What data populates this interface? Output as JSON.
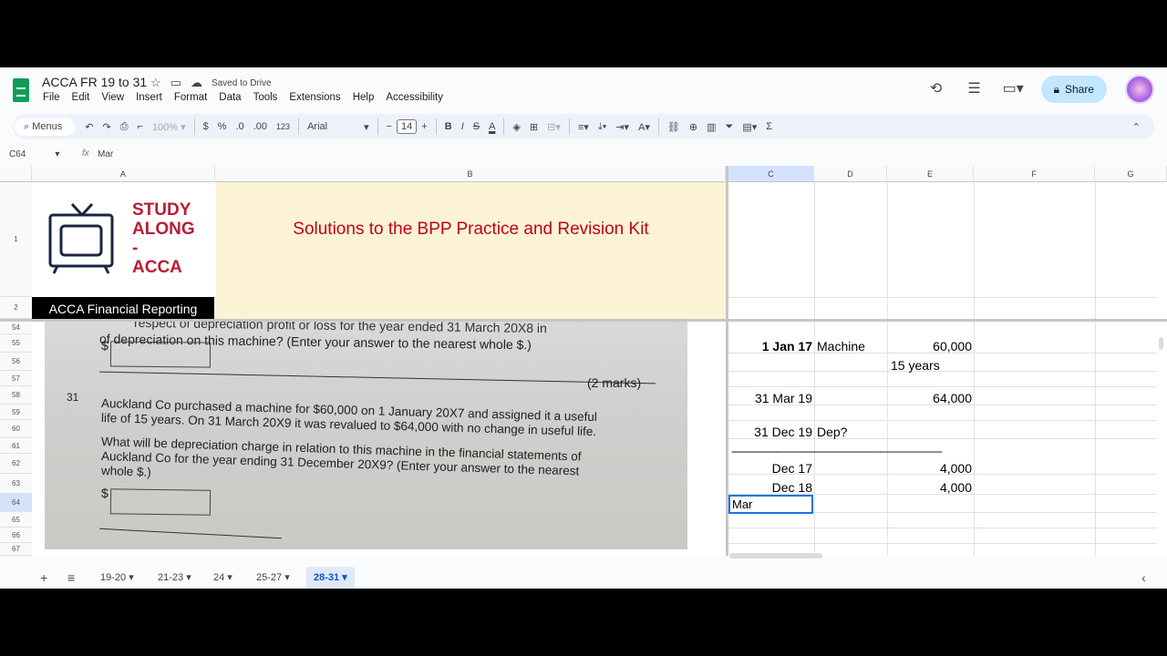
{
  "doc": {
    "title": "ACCA FR 19 to 31",
    "saved": "Saved to Drive"
  },
  "menu": [
    "File",
    "Edit",
    "View",
    "Insert",
    "Format",
    "Data",
    "Tools",
    "Extensions",
    "Help",
    "Accessibility"
  ],
  "toolbar": {
    "menus": "Menus",
    "zoom": "100%",
    "currency": "$",
    "percent": "%",
    "dec_dec": ".0",
    "dec_inc": ".00",
    "numfmt": "123",
    "font": "Arial",
    "size": "14",
    "bold": "B",
    "italic": "I",
    "strike": "S",
    "textcolor": "A",
    "sum": "Σ"
  },
  "share": "Share",
  "formula": {
    "cell": "C64",
    "fx": "fx",
    "value": "Mar"
  },
  "columns": [
    "A",
    "B",
    "C",
    "D",
    "E",
    "F",
    "G"
  ],
  "rows_top": [
    "1",
    "2"
  ],
  "rows_bottom": [
    "54",
    "55",
    "56",
    "57",
    "58",
    "59",
    "60",
    "61",
    "62",
    "63",
    "64",
    "65",
    "66",
    "67"
  ],
  "banner": {
    "study": "STUDY",
    "along": "ALONG",
    "dash": "-",
    "acca": "ACCA",
    "title": "Solutions to the BPP Practice and Revision Kit",
    "label": "ACCA Financial Reporting"
  },
  "photo": {
    "l1": "of depreciation on this machine? (Enter your answer to the nearest whole $.)",
    "l0": "respect of depreciation           profit or loss for the year ended 31 March 20X8 in",
    "dollar1": "$",
    "marks": "(2 marks)",
    "qnum": "31",
    "q1": "Auckland Co purchased a machine for $60,000 on 1 January 20X7 and assigned it a useful",
    "q2": "life of 15 years. On 31 March 20X9 it was revalued to $64,000 with no change in useful life.",
    "q3": "What will be depreciation charge in relation to this machine in the financial statements of",
    "q4": "Auckland Co for the year ending 31 December 20X9? (Enter your answer to the nearest",
    "q5": "whole $.)",
    "dollar2": "$"
  },
  "cells": {
    "c55": "1 Jan 17",
    "d55": "Machine",
    "e55": "60,000",
    "e56": "15 years",
    "c58": "31 Mar 19",
    "e58": "64,000",
    "c60": "31 Dec 19",
    "d60": "Dep?",
    "dashes": "-----------------------------------------------------------------------------",
    "c62": "Dec 17",
    "e62": "4,000",
    "c63": "Dec 18",
    "e63": "4,000",
    "c64": "Mar"
  },
  "sheets": [
    "19-20",
    "21-23",
    "24",
    "25-27",
    "28-31"
  ],
  "active_sheet": "28-31"
}
